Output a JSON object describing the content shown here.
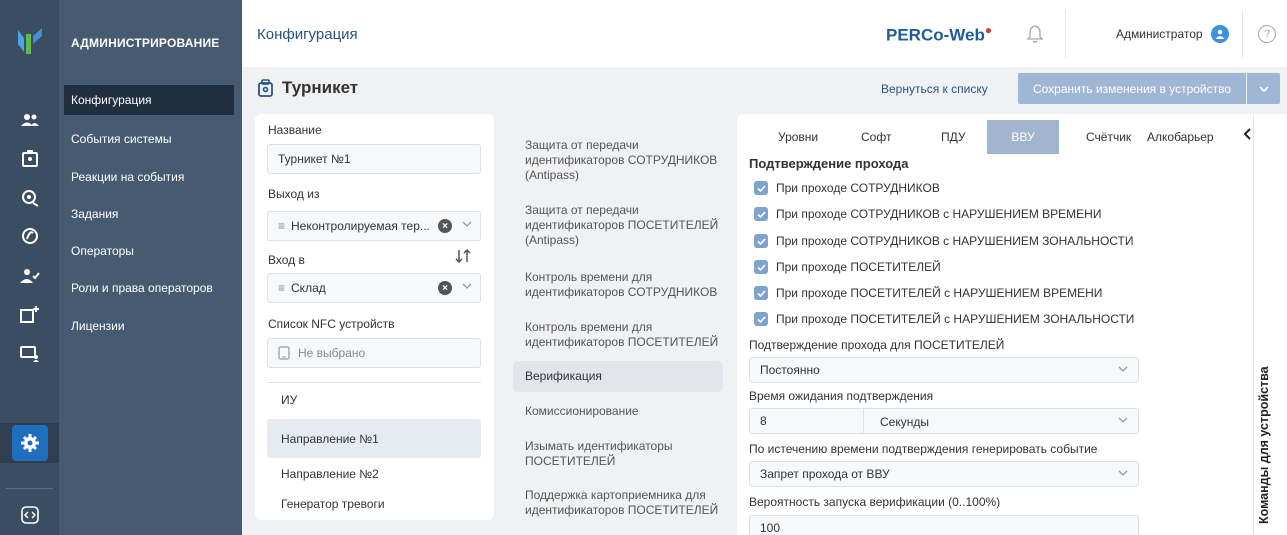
{
  "header": {
    "page_title": "Конфигурация",
    "brand": "PERCo-Web",
    "user": "Администратор",
    "help": "?"
  },
  "sidebar": {
    "title": "АДМИНИСТРИРОВАНИЕ",
    "items": [
      {
        "label": "Конфигурация",
        "active": true
      },
      {
        "label": "События системы"
      },
      {
        "label": "Реакции на события"
      },
      {
        "label": "Задания"
      },
      {
        "label": "Операторы"
      },
      {
        "label": "Роли и права операторов"
      },
      {
        "label": "Лицензии"
      }
    ]
  },
  "rail_icons": [
    "users-icon",
    "building-badge-icon",
    "face-id-icon",
    "shield-icon",
    "user-check-icon",
    "building-add-icon",
    "monitor-user-icon",
    "settings-icon",
    "code-icon"
  ],
  "toolbar": {
    "device_title": "Турникет",
    "back_label": "Вернуться к списку",
    "save_label": "Сохранить изменения в устройство"
  },
  "form": {
    "name_label": "Название",
    "name_value": "Турникет №1",
    "exit_label": "Выход из",
    "exit_value": "Неконтролируемая тер...",
    "entry_label": "Вход в",
    "entry_value": "Склад",
    "nfc_label": "Список NFC устройств",
    "nfc_placeholder": "Не выбрано",
    "devices": [
      {
        "label": "ИУ"
      },
      {
        "label": "Направление №1",
        "active": true
      },
      {
        "label": "Направление №2"
      },
      {
        "label": "Генератор тревоги"
      }
    ]
  },
  "params_list": [
    {
      "label": "Защита от передачи идентификаторов СОТРУДНИКОВ (Antipass)"
    },
    {
      "label": "Защита от передачи идентификаторов ПОСЕТИТЕЛЕЙ (Antipass)"
    },
    {
      "label": "Контроль времени для идентификаторов СОТРУДНИКОВ"
    },
    {
      "label": "Контроль времени для идентификаторов ПОСЕТИТЕЛЕЙ"
    },
    {
      "label": "Верификация",
      "active": true
    },
    {
      "label": "Комиссионирование"
    },
    {
      "label": "Изымать идентификаторы ПОСЕТИТЕЛЕЙ"
    },
    {
      "label": "Поддержка картоприемника для идентификаторов ПОСЕТИТЕЛЕЙ"
    }
  ],
  "tabs": [
    {
      "label": "Уровни"
    },
    {
      "label": "Софт"
    },
    {
      "label": "ПДУ"
    },
    {
      "label": "ВВУ",
      "active": true
    },
    {
      "label": "Счётчик"
    },
    {
      "label": "Алкобарьер"
    }
  ],
  "verification": {
    "section_title": "Подтверждение прохода",
    "checkboxes": [
      {
        "label": "При проходе СОТРУДНИКОВ",
        "checked": true
      },
      {
        "label": "При проходе СОТРУДНИКОВ с НАРУШЕНИЕМ ВРЕМЕНИ",
        "checked": true
      },
      {
        "label": "При проходе СОТРУДНИКОВ с НАРУШЕНИЕМ ЗОНАЛЬНОСТИ",
        "checked": true
      },
      {
        "label": "При проходе ПОСЕТИТЕЛЕЙ",
        "checked": true
      },
      {
        "label": "При проходе ПОСЕТИТЕЛЕЙ с НАРУШЕНИЕМ ВРЕМЕНИ",
        "checked": true
      },
      {
        "label": "При проходе ПОСЕТИТЕЛЕЙ с НАРУШЕНИЕМ ЗОНАЛЬНОСТИ",
        "checked": true
      }
    ],
    "visitors_confirm_label": "Подтверждение прохода для ПОСЕТИТЕЛЕЙ",
    "visitors_confirm_value": "Постоянно",
    "wait_time_label": "Время ожидания подтверждения",
    "wait_time_value": "8",
    "wait_time_unit": "Секунды",
    "timeout_event_label": "По истечению времени подтверждения генерировать событие",
    "timeout_event_value": "Запрет прохода от ВВУ",
    "probability_label": "Вероятность запуска верификации (0..100%)",
    "probability_value": "100"
  },
  "commands_bar_label": "Команды для устройства"
}
